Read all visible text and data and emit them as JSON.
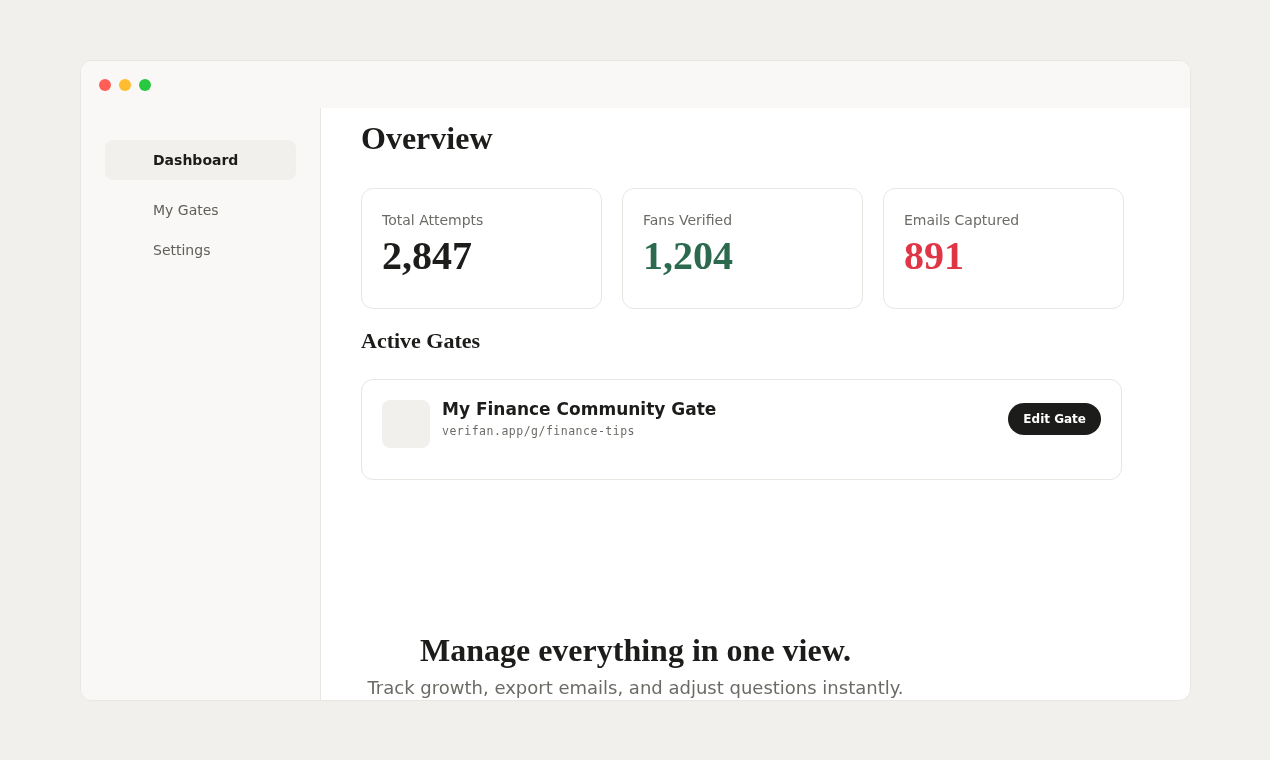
{
  "sidebar": {
    "items": [
      {
        "label": "Dashboard",
        "selected": true
      },
      {
        "label": "My Gates",
        "selected": false
      },
      {
        "label": "Settings",
        "selected": false
      }
    ]
  },
  "overview": {
    "title": "Overview",
    "stats": [
      {
        "label": "Total Attempts",
        "value": "2,847",
        "color": "#1c1c1a"
      },
      {
        "label": "Fans Verified",
        "value": "1,204",
        "color": "#2b6a4e"
      },
      {
        "label": "Emails Captured",
        "value": "891",
        "color": "#e03545"
      }
    ]
  },
  "active_gates": {
    "title": "Active Gates",
    "gates": [
      {
        "name": "My Finance Community Gate",
        "url": "verifan.app/g/finance-tips",
        "button": "Edit Gate"
      }
    ]
  },
  "caption": {
    "headline": "Manage everything in one view.",
    "text": "Track growth, export emails, and adjust questions instantly."
  }
}
